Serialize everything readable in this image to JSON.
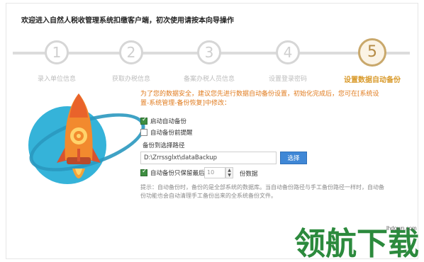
{
  "header": {
    "title": "欢迎进入自然人税收管理系统扣缴客户端，初次使用请按本向导操作"
  },
  "steps": [
    {
      "number": "1",
      "label": "录入单位信息",
      "active": false
    },
    {
      "number": "2",
      "label": "获取办税信息",
      "active": false
    },
    {
      "number": "3",
      "label": "备案办税人员信息",
      "active": false
    },
    {
      "number": "4",
      "label": "设置登录密码",
      "active": false
    },
    {
      "number": "5",
      "label": "设置数据自动备份",
      "active": true
    }
  ],
  "content": {
    "notice": "为了您的数据安全，建议您先进行数据自动备份设置，初始化完成后，您可在[系统设置-系统管理-备份恢复]中修改：",
    "auto_backup": {
      "label": "启动自动备份",
      "checked": true
    },
    "backup_reminder": {
      "label": "自动备份前提醒",
      "checked": false
    },
    "path_label": "备份到选择路径",
    "path_value": "D:\\Zrrssglxt\\dataBackup",
    "browse_label": "选择",
    "keep_latest": {
      "label": "自动备份只保留最后",
      "checked": true,
      "value": "10",
      "suffix": "份数据"
    },
    "tip": "提示：自动备份时，备份的是全部系统的数据库。当自动备份路径与手工备份路径一样时，自动备份功能也会自动清理手工备份出来的全系统备份文件。"
  },
  "watermark": {
    "logo_text": "领航下载",
    "url": "lhdown.com"
  },
  "colors": {
    "accent": "#d99a2b",
    "notice": "#e07b1e",
    "button": "#3f87d6",
    "check": "#3e8e41"
  }
}
